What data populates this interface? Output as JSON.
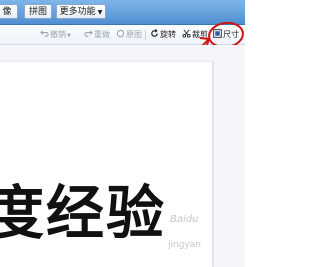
{
  "topbar": {
    "tab_left": "像",
    "tab_crop": "拼图",
    "tab_more": "更多功能"
  },
  "toolbar": {
    "undo": "撤销",
    "redo": "重做",
    "original": "原图",
    "rotate": "旋转",
    "crop": "裁剪",
    "size": "尺寸"
  },
  "canvas": {
    "text": "度经验",
    "watermark1": "Baidu",
    "watermark2": "jingyan"
  },
  "colors": {
    "toolbar_blue": "#4f8fd2",
    "annotation_red": "#d11414"
  }
}
